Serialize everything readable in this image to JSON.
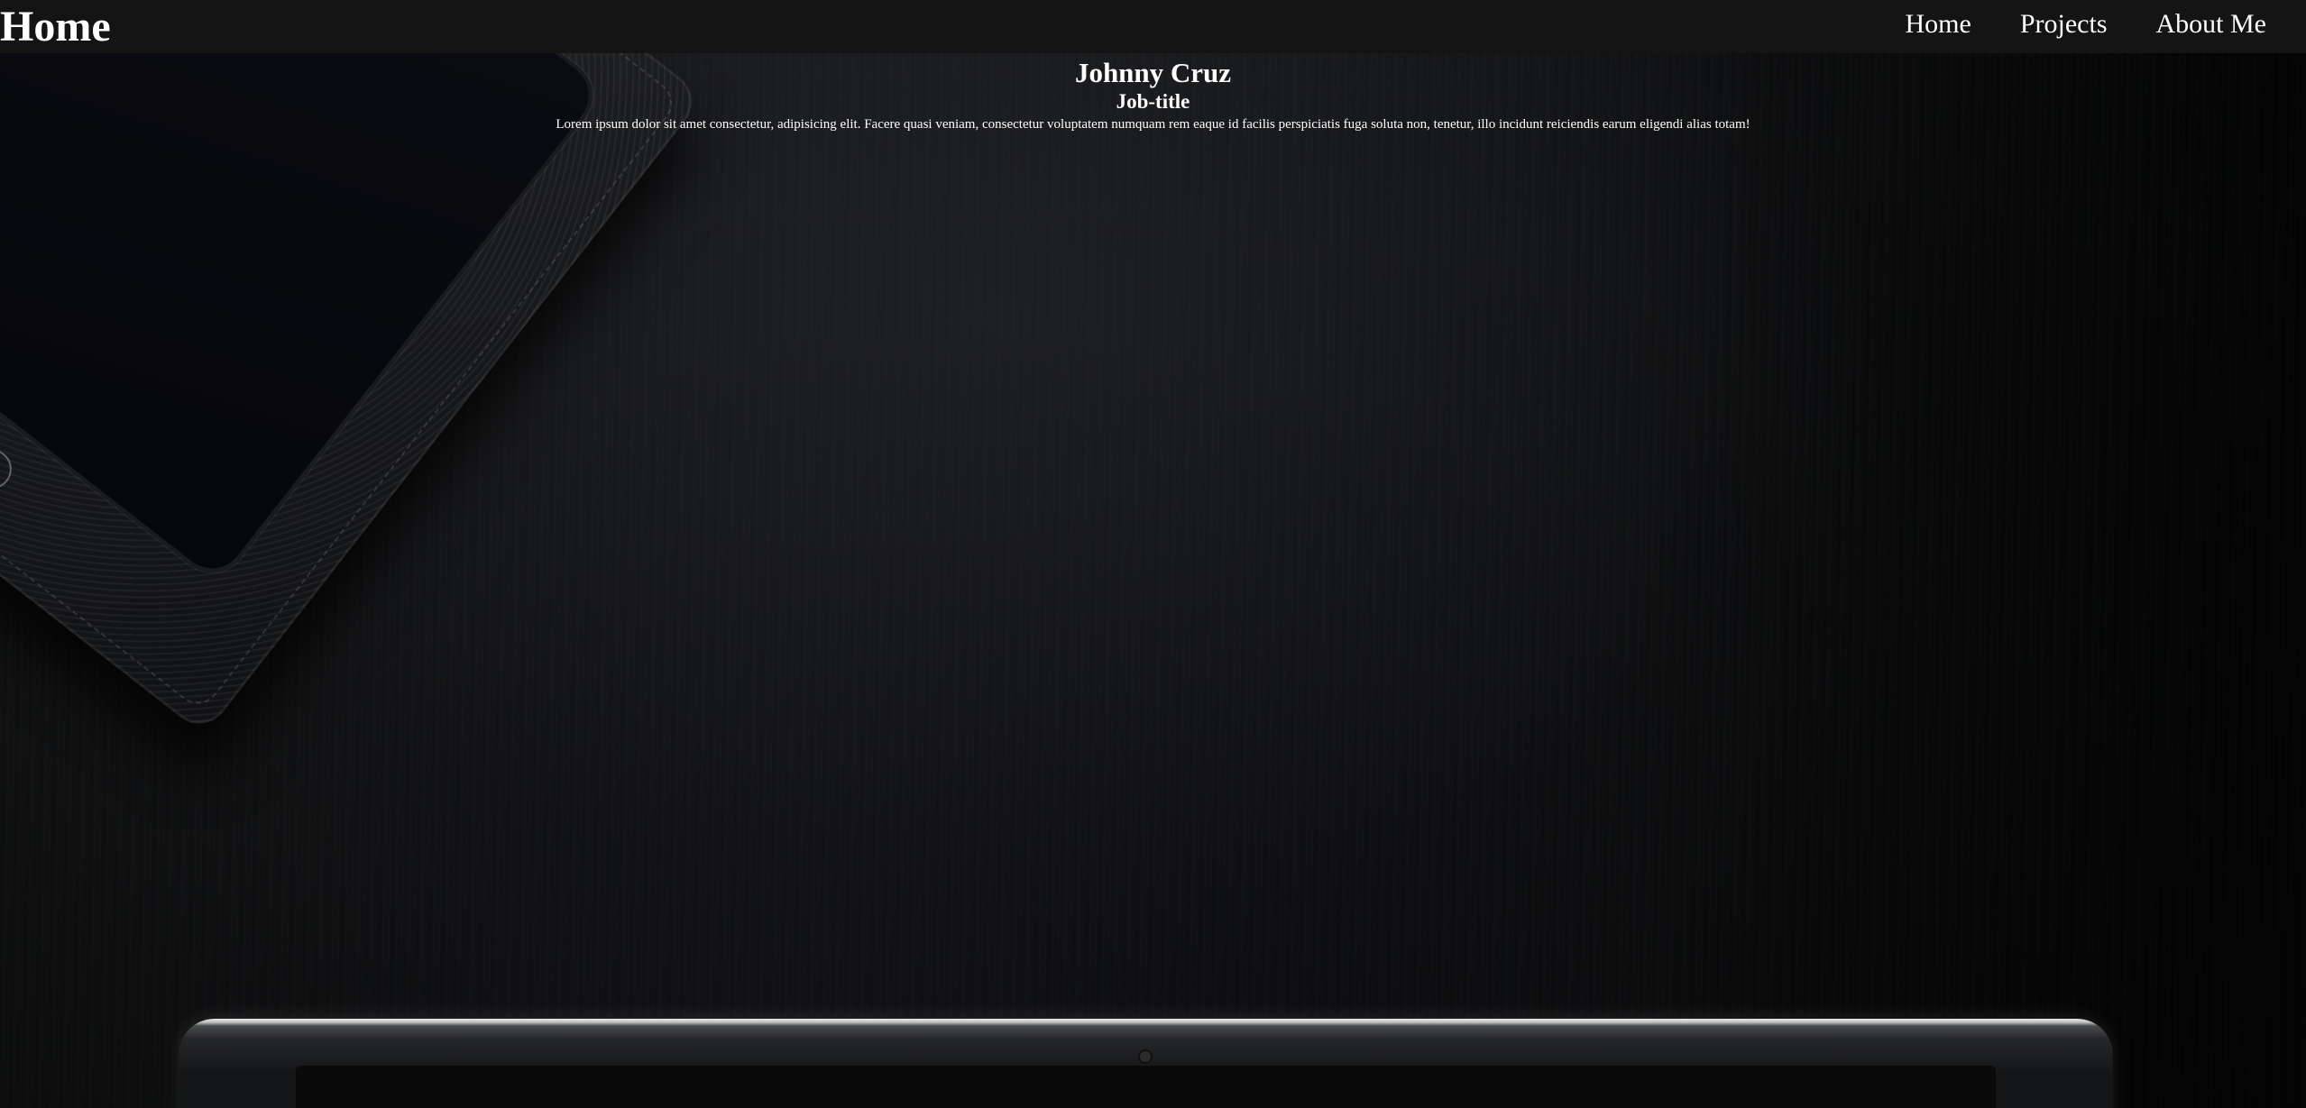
{
  "navbar": {
    "brand": "Home",
    "links": [
      {
        "label": "Home"
      },
      {
        "label": "Projects"
      },
      {
        "label": "About Me"
      }
    ]
  },
  "hero": {
    "name": "Johnny Cruz",
    "job_title": "Job-title",
    "bio": "Lorem ipsum dolor sit amet consectetur, adipisicing elit. Facere quasi veniam, consectetur voluptatem numquam rem eaque id facilis perspiciatis fuga soluta non, tenetur, illo incidunt reiciendis earum eligendi alias totam!"
  },
  "colors": {
    "navbar_background": "#141414",
    "text": "#ffffff",
    "page_background": "#0b0c0d"
  }
}
